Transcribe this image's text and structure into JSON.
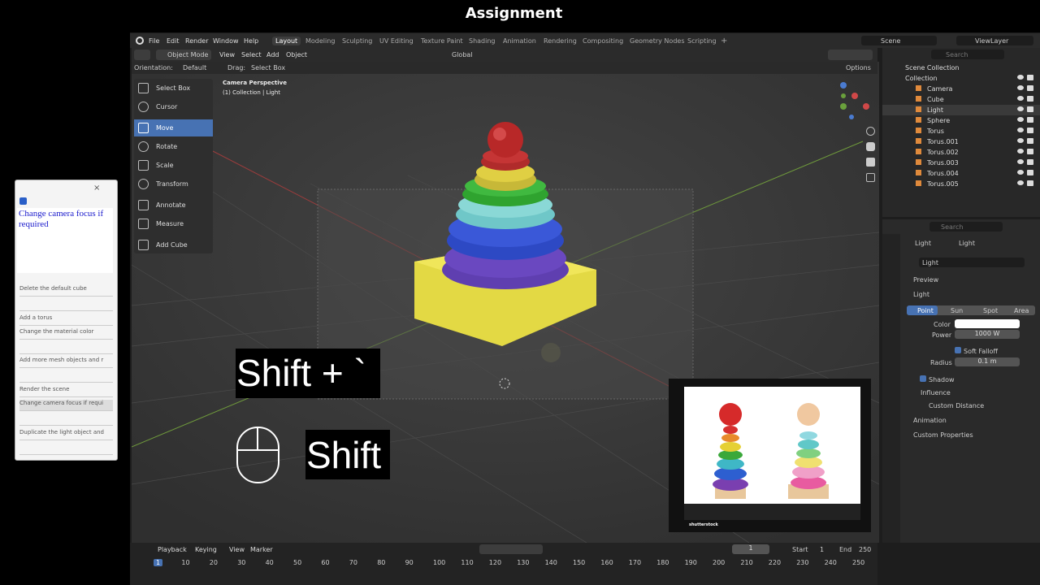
{
  "title": "Assignment",
  "topbar": {
    "menus": [
      "File",
      "Edit",
      "Render",
      "Window",
      "Help"
    ],
    "workspaces": [
      "Layout",
      "Modeling",
      "Sculpting",
      "UV Editing",
      "Texture Paint",
      "Shading",
      "Animation",
      "Rendering",
      "Compositing",
      "Geometry Nodes",
      "Scripting"
    ],
    "active_workspace": "Layout",
    "add_tab": "+",
    "scene": "Scene",
    "view_layer": "ViewLayer"
  },
  "header": {
    "mode": "Object Mode",
    "menus": [
      "View",
      "Select",
      "Add",
      "Object"
    ],
    "transform": "Global",
    "orientation_label": "Orientation:",
    "orientation": "Default",
    "drag_label": "Drag:",
    "drag": "Select Box",
    "options": "Options"
  },
  "viewport": {
    "line1": "Camera Perspective",
    "line2": "(1) Collection | Light"
  },
  "tools": [
    "Select Box",
    "Cursor",
    "Move",
    "Rotate",
    "Scale",
    "Transform",
    "Annotate",
    "Measure",
    "Add Cube"
  ],
  "active_tool": "Move",
  "outliner": {
    "search_placeholder": "Search",
    "root": "Scene Collection",
    "collection": "Collection",
    "items": [
      "Camera",
      "Cube",
      "Light",
      "Sphere",
      "Torus",
      "Torus.001",
      "Torus.002",
      "Torus.003",
      "Torus.004",
      "Torus.005"
    ]
  },
  "properties": {
    "search_placeholder": "Search",
    "breadcrumb1": "Light",
    "breadcrumb2": "Light",
    "datablock": "Light",
    "preview": "Preview",
    "light": "Light",
    "types": [
      "Point",
      "Sun",
      "Spot",
      "Area"
    ],
    "active_type": "Point",
    "color_label": "Color",
    "color": "#ffffff",
    "power_label": "Power",
    "power": "1000 W",
    "soft_falloff": "Soft Falloff",
    "radius_label": "Radius",
    "radius": "0.1 m",
    "shadow": "Shadow",
    "influence": "Influence",
    "custom_distance": "Custom Distance",
    "animation": "Animation",
    "custom_properties": "Custom Properties"
  },
  "timeline": {
    "menus": [
      "Playback",
      "Keying",
      "View",
      "Marker"
    ],
    "current_frame": "1",
    "start_label": "Start",
    "start": "1",
    "end_label": "End",
    "end": "250",
    "ticks": [
      "1",
      "10",
      "20",
      "30",
      "40",
      "50",
      "60",
      "70",
      "80",
      "90",
      "100",
      "110",
      "120",
      "130",
      "140",
      "150",
      "160",
      "170",
      "180",
      "190",
      "200",
      "210",
      "220",
      "230",
      "240",
      "250"
    ]
  },
  "keys": {
    "shortcut": "Shift + `",
    "modifier": "Shift"
  },
  "reference_image": {
    "watermark": "shutterstock"
  },
  "todo": {
    "current": "Change camera focus if required",
    "items": [
      "Delete the default cube",
      "",
      "Add a torus",
      "Change the material color",
      "",
      "Add more mesh objects and r",
      "",
      "Render the scene",
      "Change camera focus if requi",
      "",
      "Duplicate the light object and",
      ""
    ]
  }
}
